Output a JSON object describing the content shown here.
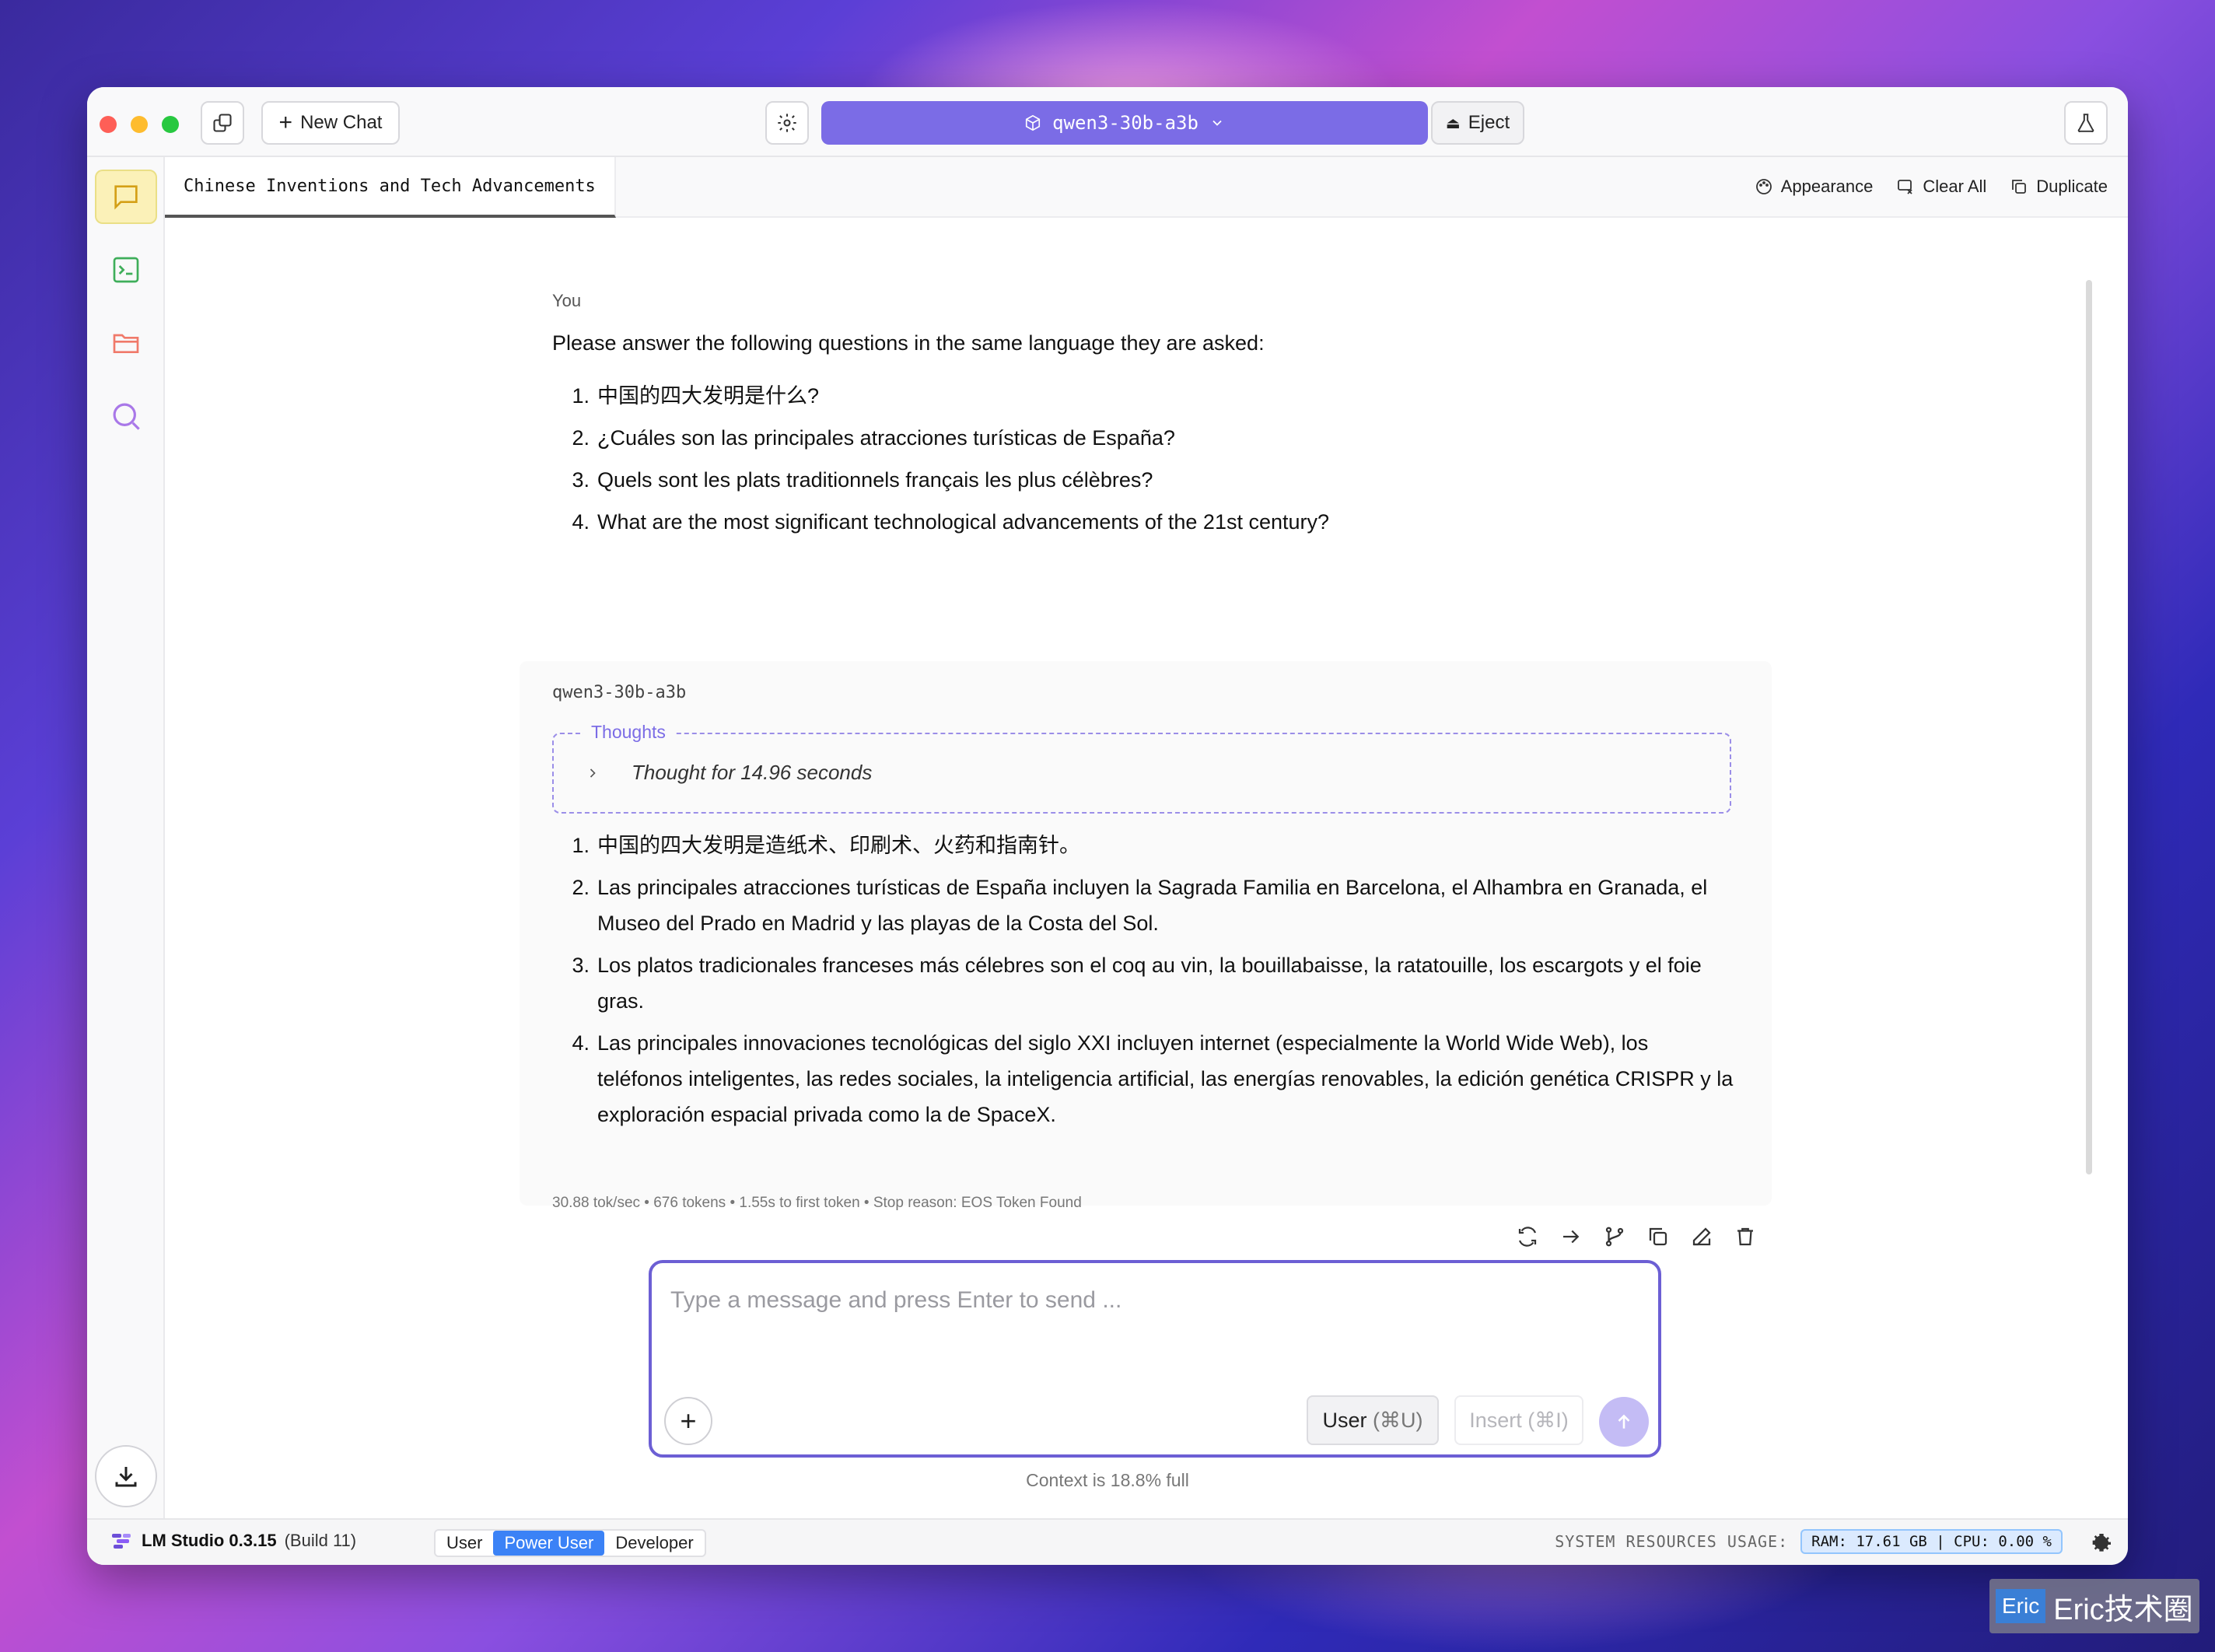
{
  "titlebar": {
    "new_chat_label": "New Chat",
    "model_name": "qwen3-30b-a3b",
    "eject_label": "Eject"
  },
  "tab": {
    "title": "Chinese Inventions and Tech Advancements",
    "actions": {
      "appearance": "Appearance",
      "clear_all": "Clear All",
      "duplicate": "Duplicate"
    }
  },
  "conversation": {
    "user_label": "You",
    "user_intro": "Please answer the following questions in the same language they are asked:",
    "user_questions": [
      {
        "n": "1.",
        "text": "中国的四大发明是什么?"
      },
      {
        "n": "2.",
        "text": "¿Cuáles son las principales atracciones turísticas de España?"
      },
      {
        "n": "3.",
        "text": "Quels sont les plats traditionnels français les plus célèbres?"
      },
      {
        "n": "4.",
        "text": "What are the most significant technological advancements of the 21st century?"
      }
    ],
    "model_label": "qwen3-30b-a3b",
    "thoughts_title": "Thoughts",
    "thoughts_summary": "Thought for 14.96 seconds",
    "answers": [
      {
        "n": "1.",
        "text": "中国的四大发明是造纸术、印刷术、火药和指南针。"
      },
      {
        "n": "2.",
        "text": "Las principales atracciones turísticas de España incluyen la Sagrada Familia en Barcelona, el Alhambra en Granada, el Museo del Prado en Madrid y las playas de la Costa del Sol."
      },
      {
        "n": "3.",
        "text": "Los platos tradicionales franceses más célebres son el coq au vin, la bouillabaisse, la ratatouille, los escargots y el foie gras."
      },
      {
        "n": "4.",
        "text": "Las principales innovaciones tecnológicas del siglo XXI incluyen internet (especialmente la World Wide Web), los teléfonos inteligentes, las redes sociales, la inteligencia artificial, las energías renovables, la edición genética CRISPR y la exploración espacial privada como la de SpaceX."
      }
    ],
    "stats": "30.88 tok/sec  •  676 tokens  •  1.55s to first token  •  Stop reason: EOS Token Found"
  },
  "composer": {
    "placeholder": "Type a message and press Enter to send ...",
    "user_role_label": "User",
    "user_role_shortcut": "(⌘U)",
    "insert_label": "Insert",
    "insert_shortcut": "(⌘I)",
    "context_status": "Context is 18.8% full"
  },
  "statusbar": {
    "app_name": "LM Studio 0.3.15",
    "build": "(Build 11)",
    "modes": [
      "User",
      "Power User",
      "Developer"
    ],
    "active_mode": "Power User",
    "resources_label": "SYSTEM RESOURCES USAGE:",
    "resources_value": "RAM: 17.61 GB  |  CPU: 0.00 %"
  },
  "watermark": {
    "logo": "Eric",
    "text": "Eric技术圈"
  },
  "colors": {
    "accent": "#7b6ce6",
    "composer_border": "#6c5fd4",
    "active_mode": "#3b82f6",
    "chat_icon": "#d4a017",
    "terminal_icon": "#3fae5a",
    "folder_icon": "#f07a6a",
    "search_icon": "#a978e8"
  }
}
